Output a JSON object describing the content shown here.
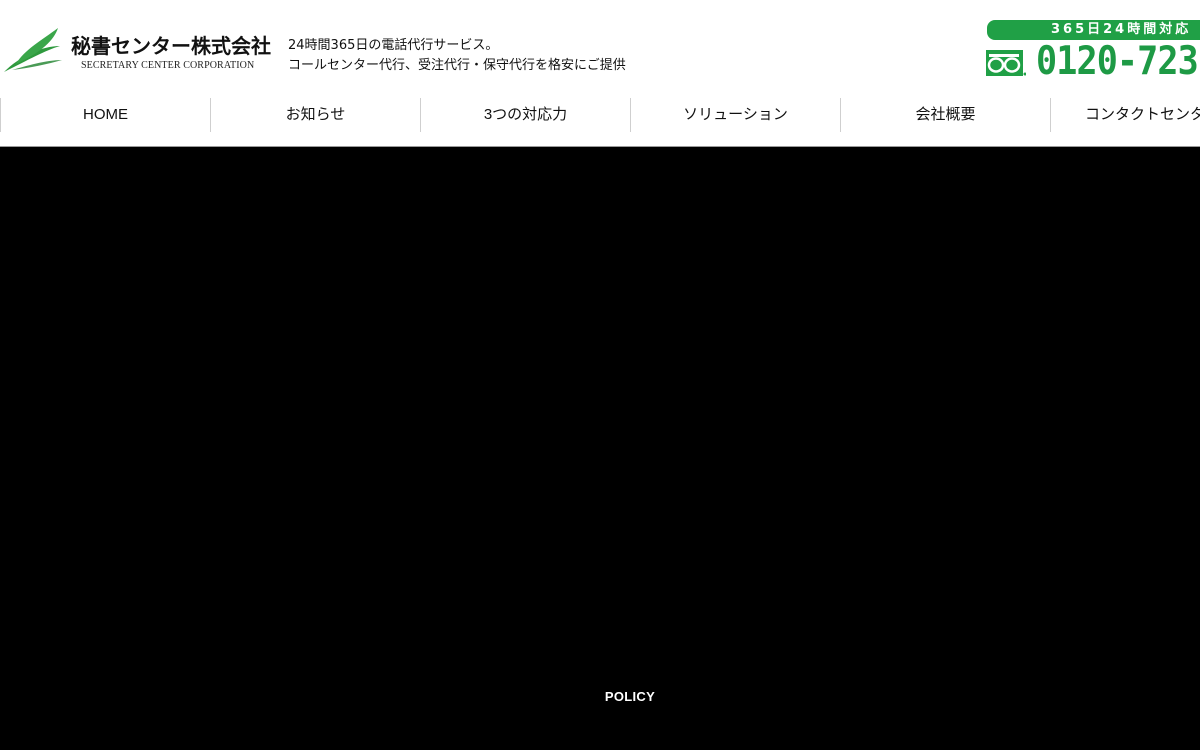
{
  "logo": {
    "name_jp": "秘書センター株式会社",
    "name_en": "SECRETARY CENTER CORPORATION"
  },
  "tagline": {
    "line1": "24時間365日の電話代行サービス。",
    "line2": "コールセンター代行、受注代行・保守代行を格安にご提供"
  },
  "phone": {
    "badge": "365日24時間対応",
    "number": "0120-723-",
    "icon": "freedial-icon",
    "accent_color": "#20a046"
  },
  "nav": {
    "items": [
      {
        "label": "HOME"
      },
      {
        "label": "お知らせ"
      },
      {
        "label": "3つの対応力"
      },
      {
        "label": "ソリューション"
      },
      {
        "label": "会社概要"
      },
      {
        "label": "コンタクトセンタ"
      }
    ]
  },
  "footer": {
    "policy_label": "POLICY"
  }
}
